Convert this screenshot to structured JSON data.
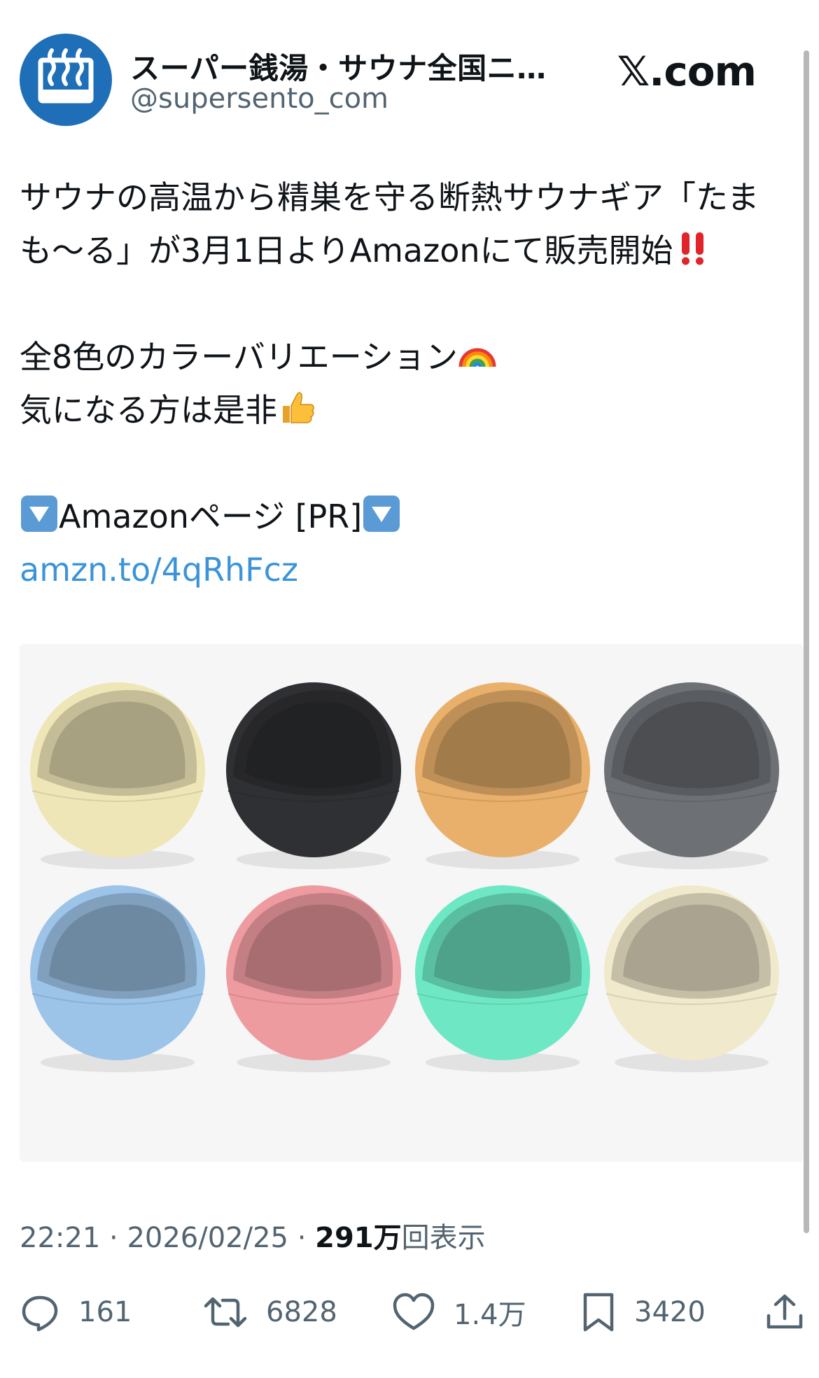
{
  "header": {
    "display_name": "スーパー銭湯・サウナ全国ニ…",
    "handle": "@supersento_com",
    "site_logo": "𝕏.com",
    "avatar_icon": "hot-spring-icon"
  },
  "tweet": {
    "line1": "サウナの高温から精巣を守る断熱サウナギア「たま",
    "line2": "も〜る」が3月1日よりAmazonにて販売開始",
    "line3": "全8色のカラーバリエーション",
    "line4": "気になる方は是非",
    "line5": "Amazonページ [PR]",
    "link": "amzn.to/4qRhFcz"
  },
  "photo": {
    "icon": "product-photo",
    "products": [
      {
        "name": "cream",
        "color": "#efe6b8"
      },
      {
        "name": "black",
        "color": "#2f3033"
      },
      {
        "name": "orange",
        "color": "#e8b06a"
      },
      {
        "name": "gray",
        "color": "#6d7075"
      },
      {
        "name": "blue",
        "color": "#9cc3e8"
      },
      {
        "name": "pink",
        "color": "#ee9ba0"
      },
      {
        "name": "mint",
        "color": "#6ee8c4"
      },
      {
        "name": "ivory",
        "color": "#f1e9cc"
      }
    ]
  },
  "meta": {
    "time": "22:21",
    "date": "2026/02/25",
    "views_count": "291万",
    "views_label": "回表示"
  },
  "actions": {
    "replies": "161",
    "reposts": "6828",
    "likes": "1.4万",
    "bookmarks": "3420"
  },
  "colors": {
    "link": "#3b94d9",
    "secondary_text": "#536471",
    "avatar_bg": "#1f6fb8"
  }
}
